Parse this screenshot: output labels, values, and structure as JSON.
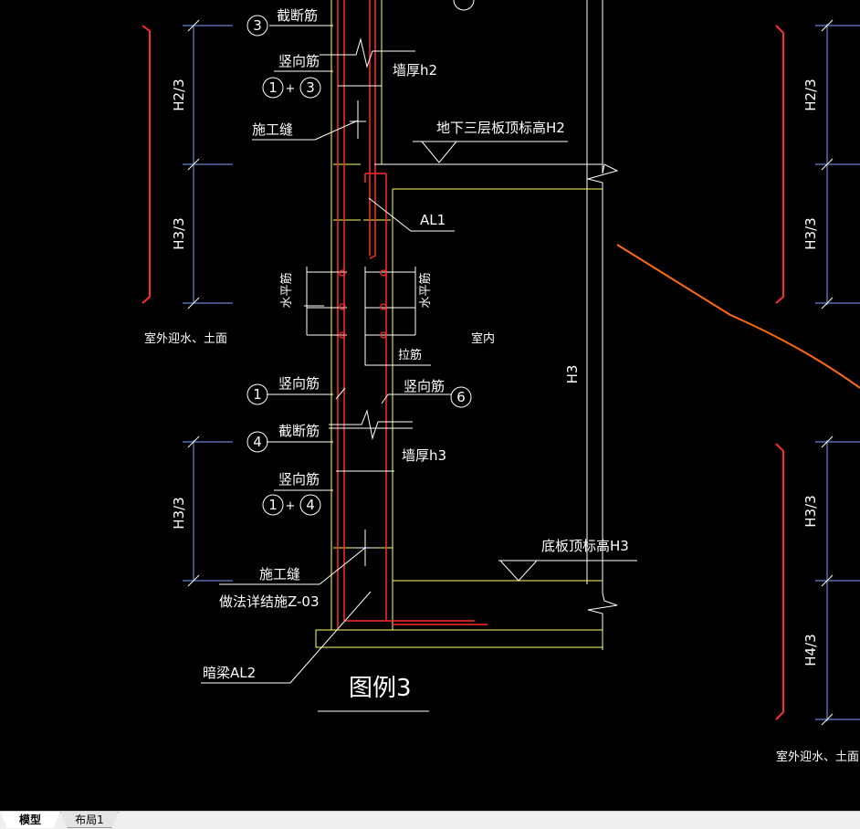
{
  "drawing": {
    "labels": {
      "cut_bar_top": "截断筋",
      "vertical_bar_top": "竖向筋",
      "wall_thickness_h2": "墙厚h2",
      "construction_joint_top": "施工缝",
      "slab_top_level_h2": "地下三层板顶标高H2",
      "hidden_beam_al1": "AL1",
      "horizontal_bar_left": "水平筋",
      "horizontal_bar_right": "水平筋",
      "tie_bar": "拉筋",
      "outdoor_left": "室外迎水、土面",
      "indoor": "室内",
      "vertical_bar_mid": "竖向筋",
      "vertical_bar_right": "竖向筋",
      "cut_bar_bottom": "截断筋",
      "wall_thickness_h3": "墙厚h3",
      "vertical_bar_bottom": "竖向筋",
      "h3_vertical": "H3",
      "bottom_slab_level_h3": "底板顶标高H3",
      "construction_joint_bottom": "施工缝",
      "joint_detail_ref": "做法详结施Z-03",
      "hidden_beam_al2": "暗梁AL2",
      "figure_title": "图例3",
      "outdoor_right": "室外迎水、土面"
    },
    "dimensions": {
      "left_top_h2": "H2/3",
      "left_top_h3": "H3/3",
      "left_bottom_h3": "H3/3",
      "right_top_h2": "H2/3",
      "right_top_h3": "H3/3",
      "right_bottom_h3": "H3/3",
      "right_bottom_h4": "H4/3"
    },
    "markers": {
      "m3": "3",
      "m1a": "1",
      "plus_a": "+",
      "m3b": "3",
      "m1": "1",
      "m6": "6",
      "m4": "4",
      "m1b": "1",
      "plus_b": "+",
      "m4b": "4"
    },
    "colors": {
      "background": "#000000",
      "line_white": "#ffffff",
      "line_yellow": "#ffff66",
      "line_red": "#ff2a2a",
      "line_blue": "#7f9fff",
      "line_orange": "#ff6a10"
    }
  },
  "tabs": {
    "model": "模型",
    "layout1": "布局1"
  }
}
